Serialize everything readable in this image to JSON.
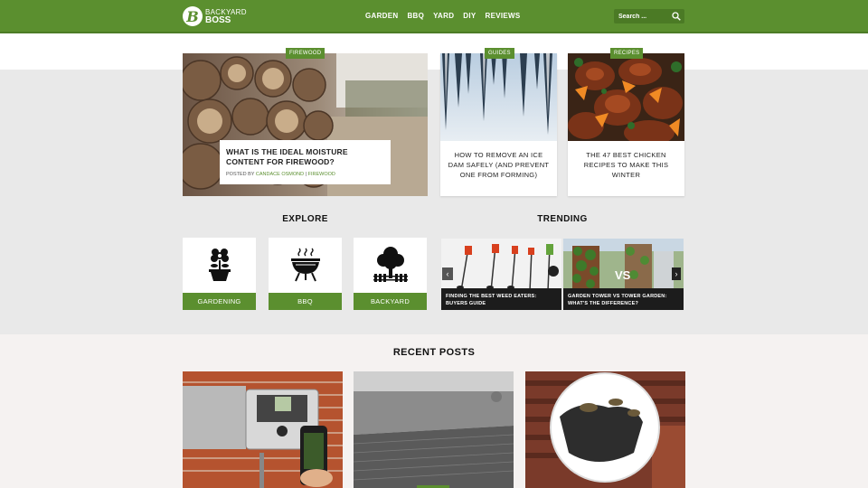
{
  "header": {
    "logo_line1": "BACKYARD",
    "logo_line2": "BOSS",
    "logo_glyph": "B",
    "nav": [
      "GARDEN",
      "BBQ",
      "YARD",
      "DIY",
      "REVIEWS"
    ],
    "search_placeholder": "Search ...",
    "brand_color": "#5b8f2f"
  },
  "featured": {
    "main": {
      "tag": "FIREWOOD",
      "title": "WHAT IS THE IDEAL MOISTURE CONTENT FOR FIREWOOD?",
      "posted_by": "POSTED BY",
      "author": "CANDACE OSMOND",
      "separator": "|",
      "category": "FIREWOOD"
    },
    "cards": [
      {
        "tag": "GUIDES",
        "title": "HOW TO REMOVE AN ICE DAM SAFELY (AND PREVENT ONE FROM FORMING)"
      },
      {
        "tag": "RECIPES",
        "title": "THE 47 BEST CHICKEN RECIPES TO MAKE THIS WINTER"
      }
    ]
  },
  "explore": {
    "title": "EXPLORE",
    "items": [
      {
        "label": "GARDENING",
        "icon": "flower-pot-icon"
      },
      {
        "label": "BBQ",
        "icon": "grill-icon"
      },
      {
        "label": "BACKYARD",
        "icon": "tree-fence-icon"
      }
    ]
  },
  "trending": {
    "title": "TRENDING",
    "items": [
      {
        "caption": "FINDING THE BEST WEED EATERS: BUYERS GUIDE"
      },
      {
        "caption": "GARDEN TOWER VS TOWER GARDEN: WHAT'S THE DIFFERENCE?"
      }
    ],
    "vs_text": "VS",
    "prev": "‹",
    "next": "›"
  },
  "recent": {
    "title": "RECENT POSTS"
  }
}
